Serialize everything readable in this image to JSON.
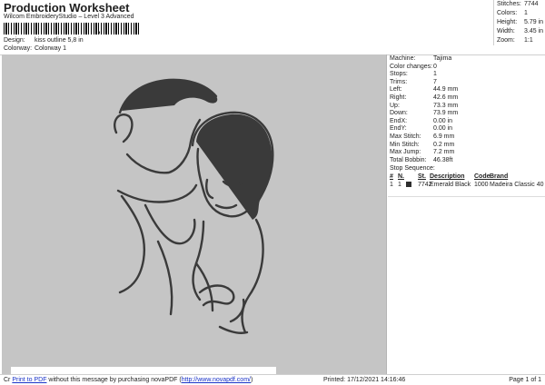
{
  "header": {
    "title": "Production Worksheet",
    "subtitle": "Wilcom EmbroideryStudio – Level 3 Advanced",
    "barcode_sep": ",",
    "design_label": "Design:",
    "design_value": "kiss outline 5,8 in",
    "colorway_label": "Colorway:",
    "colorway_value": "Colorway 1"
  },
  "stats": [
    {
      "k": "Stitches:",
      "v": "7744"
    },
    {
      "k": "Colors:",
      "v": "1"
    },
    {
      "k": "Height:",
      "v": "5.79 in"
    },
    {
      "k": "Width:",
      "v": "3.45 in"
    },
    {
      "k": "Zoom:",
      "v": "1:1"
    }
  ],
  "machine": [
    {
      "k": "Machine:",
      "v": "Tajima"
    },
    {
      "k": "Color changes:",
      "v": "0"
    },
    {
      "k": "Stops:",
      "v": "1"
    },
    {
      "k": "Trims:",
      "v": "7"
    },
    {
      "k": "Left:",
      "v": "44.9 mm"
    },
    {
      "k": "Right:",
      "v": "42.6 mm"
    },
    {
      "k": "Up:",
      "v": "73.3 mm"
    },
    {
      "k": "Down:",
      "v": "73.9 mm"
    },
    {
      "k": "EndX:",
      "v": "0.00 in"
    },
    {
      "k": "EndY:",
      "v": "0.00 in"
    },
    {
      "k": "Max Stitch:",
      "v": "6.9 mm"
    },
    {
      "k": "Min Stitch:",
      "v": "0.2 mm"
    },
    {
      "k": "Max Jump:",
      "v": "7.2 mm"
    },
    {
      "k": "Total Bobbin:",
      "v": "46.38ft"
    }
  ],
  "sequence": {
    "title": "Stop Sequence:",
    "headers": {
      "n": "#",
      "n2": "N.",
      "st": "St.",
      "desc": "Description",
      "code": "Code",
      "brand": "Brand"
    },
    "rows": [
      {
        "n": "1",
        "n2": "1",
        "st": "7742",
        "desc": "Emerald Black",
        "code": "1000",
        "brand": "Madeira Classic 40",
        "color": "#2e2e2e"
      }
    ]
  },
  "footer": {
    "prefix": "Cr",
    "link_text": "Print to PDF",
    "middle": " without this message by purchasing novaPDF (",
    "url": "http://www.novapdf.com/",
    "suffix": ")",
    "printed": "Printed: 17/12/2021 14:16:46",
    "page": "Page 1 of 1"
  },
  "colors": {
    "thread": "#3a3a3a",
    "canvas": "#c5c5c5",
    "link": "#1a33c8"
  }
}
